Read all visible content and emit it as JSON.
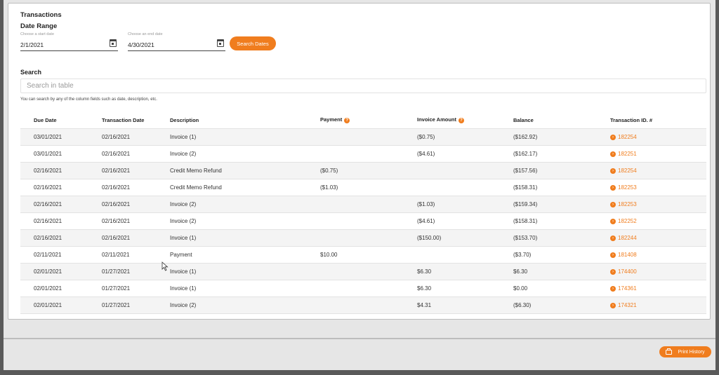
{
  "card": {
    "title": "Transactions",
    "range_label": "Date Range"
  },
  "date_range": {
    "start": {
      "hint": "Choose a start date",
      "value": "2/1/2021"
    },
    "end": {
      "hint": "Choose an end date",
      "value": "4/30/2021"
    },
    "search_button": "Search Dates"
  },
  "search": {
    "heading": "Search",
    "placeholder": "Search in table",
    "help": "You can search by any of the column fields such as date, description, etc."
  },
  "table": {
    "columns": [
      "Due Date",
      "Transaction Date",
      "Description",
      "Payment",
      "Invoice Amount",
      "Balance",
      "Transaction ID. #"
    ],
    "rows": [
      {
        "due": "03/01/2021",
        "tdate": "02/16/2021",
        "desc": "Invoice (1)",
        "payment": "",
        "invoice": "($0.75)",
        "balance": "($162.92)",
        "id": "182254"
      },
      {
        "due": "03/01/2021",
        "tdate": "02/16/2021",
        "desc": "Invoice (2)",
        "payment": "",
        "invoice": "($4.61)",
        "balance": "($162.17)",
        "id": "182251"
      },
      {
        "due": "02/16/2021",
        "tdate": "02/16/2021",
        "desc": "Credit Memo Refund",
        "payment": "($0.75)",
        "invoice": "",
        "balance": "($157.56)",
        "id": "182254"
      },
      {
        "due": "02/16/2021",
        "tdate": "02/16/2021",
        "desc": "Credit Memo Refund",
        "payment": "($1.03)",
        "invoice": "",
        "balance": "($158.31)",
        "id": "182253"
      },
      {
        "due": "02/16/2021",
        "tdate": "02/16/2021",
        "desc": "Invoice (2)",
        "payment": "",
        "invoice": "($1.03)",
        "balance": "($159.34)",
        "id": "182253"
      },
      {
        "due": "02/16/2021",
        "tdate": "02/16/2021",
        "desc": "Invoice (2)",
        "payment": "",
        "invoice": "($4.61)",
        "balance": "($158.31)",
        "id": "182252"
      },
      {
        "due": "02/16/2021",
        "tdate": "02/16/2021",
        "desc": "Invoice (1)",
        "payment": "",
        "invoice": "($150.00)",
        "balance": "($153.70)",
        "id": "182244"
      },
      {
        "due": "02/11/2021",
        "tdate": "02/11/2021",
        "desc": "Payment",
        "payment": "$10.00",
        "invoice": "",
        "balance": "($3.70)",
        "id": "181408"
      },
      {
        "due": "02/01/2021",
        "tdate": "01/27/2021",
        "desc": "Invoice (1)",
        "payment": "",
        "invoice": "$6.30",
        "balance": "$6.30",
        "id": "174400"
      },
      {
        "due": "02/01/2021",
        "tdate": "01/27/2021",
        "desc": "Invoice (1)",
        "payment": "",
        "invoice": "$6.30",
        "balance": "$0.00",
        "id": "174361"
      },
      {
        "due": "02/01/2021",
        "tdate": "01/27/2021",
        "desc": "Invoice (2)",
        "payment": "",
        "invoice": "$4.31",
        "balance": "($6.30)",
        "id": "174321"
      }
    ]
  },
  "footer": {
    "print_button": "Print History"
  },
  "icons": {
    "calendar": "calendar-icon",
    "help": "question-icon",
    "link": "arrow-circle-icon",
    "printer": "printer-icon"
  },
  "colors": {
    "accent": "#f07d1e"
  }
}
